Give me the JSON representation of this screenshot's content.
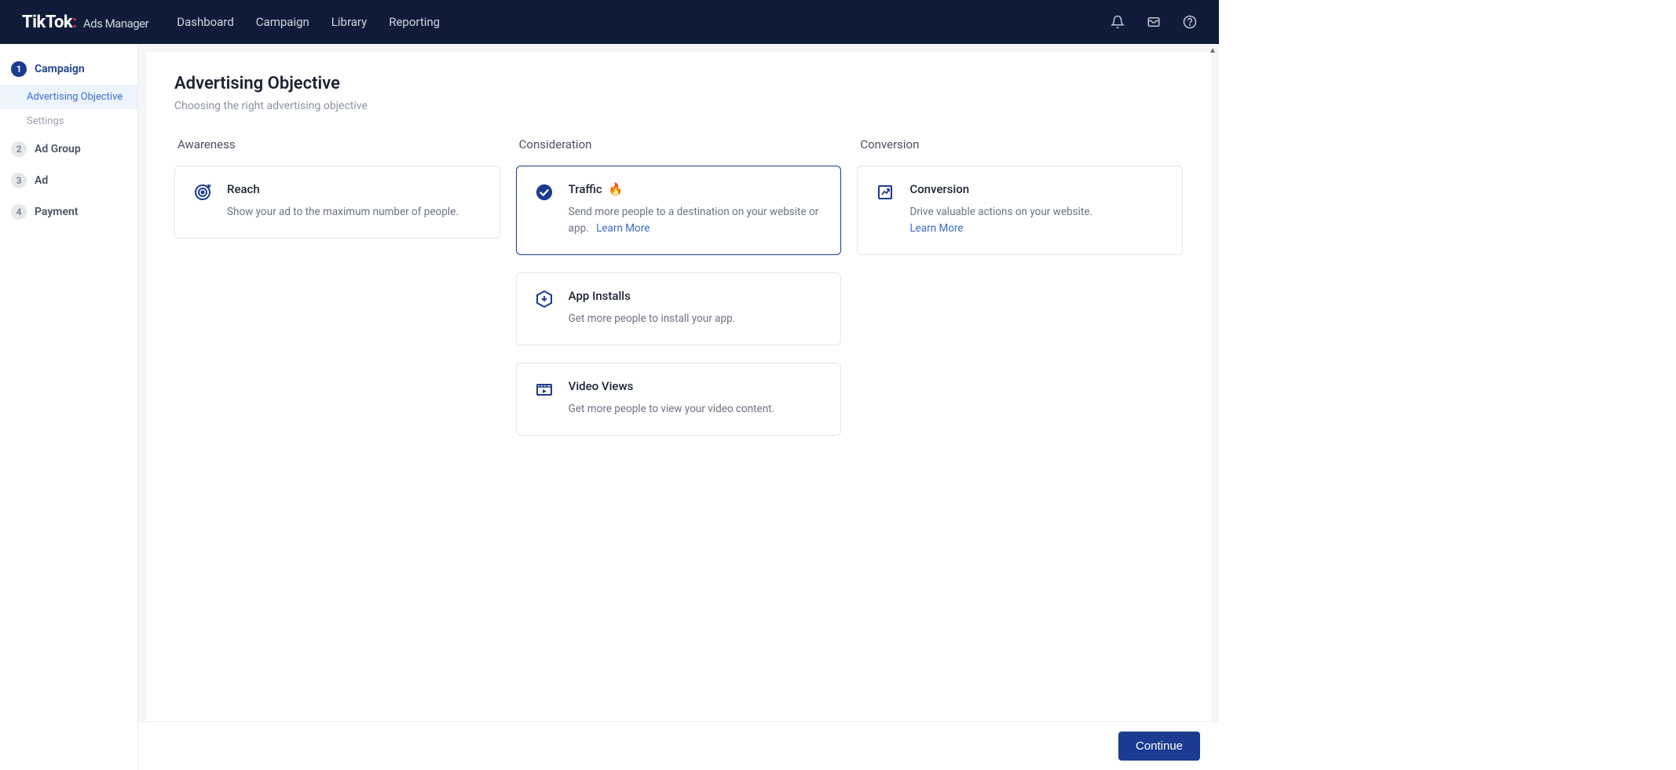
{
  "header": {
    "logo_main": "TikTok",
    "logo_sub": "Ads Manager",
    "nav": [
      "Dashboard",
      "Campaign",
      "Library",
      "Reporting"
    ]
  },
  "sidebar": {
    "steps": [
      {
        "num": "1",
        "label": "Campaign",
        "active": true,
        "subs": [
          {
            "label": "Advertising Objective",
            "active": true
          },
          {
            "label": "Settings",
            "active": false
          }
        ]
      },
      {
        "num": "2",
        "label": "Ad Group",
        "active": false,
        "subs": []
      },
      {
        "num": "3",
        "label": "Ad",
        "active": false,
        "subs": []
      },
      {
        "num": "4",
        "label": "Payment",
        "active": false,
        "subs": []
      }
    ]
  },
  "main": {
    "title": "Advertising Objective",
    "subtitle": "Choosing the right advertising objective",
    "columns": [
      {
        "header": "Awareness",
        "cards": [
          {
            "icon": "target",
            "title": "Reach",
            "hot": false,
            "selected": false,
            "desc": "Show your ad to the maximum number of people.",
            "learn_more": null
          }
        ]
      },
      {
        "header": "Consideration",
        "cards": [
          {
            "icon": "check",
            "title": "Traffic",
            "hot": true,
            "selected": true,
            "desc": "Send more people to a destination on your website or app.",
            "learn_more": "Learn More"
          },
          {
            "icon": "hex",
            "title": "App Installs",
            "hot": false,
            "selected": false,
            "desc": "Get more people to install your app.",
            "learn_more": null
          },
          {
            "icon": "video",
            "title": "Video Views",
            "hot": false,
            "selected": false,
            "desc": "Get more people to view your video content.",
            "learn_more": null
          }
        ]
      },
      {
        "header": "Conversion",
        "cards": [
          {
            "icon": "chart",
            "title": "Conversion",
            "hot": false,
            "selected": false,
            "desc": "Drive valuable actions on your website.",
            "learn_more": "Learn More"
          }
        ]
      }
    ]
  },
  "footer": {
    "continue": "Continue"
  }
}
